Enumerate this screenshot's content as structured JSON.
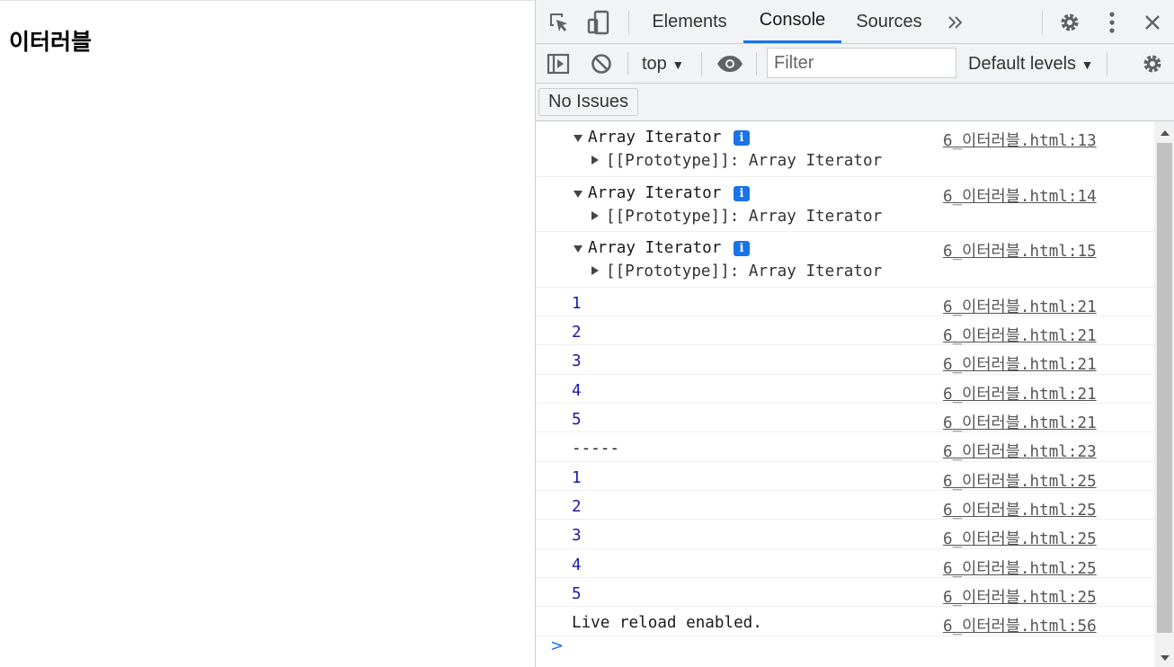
{
  "page": {
    "title": "이터러블"
  },
  "devtools": {
    "tabs": [
      {
        "label": "Elements"
      },
      {
        "label": "Console"
      },
      {
        "label": "Sources"
      }
    ],
    "more_tabs_icon": "double-chevron-right",
    "context": "top",
    "filter_placeholder": "Filter",
    "levels": "Default levels",
    "issues_label": "No Issues",
    "colors": {
      "accent": "#1a73e8",
      "number": "#1a1aa6",
      "toolbar_bg": "#f1f3f4"
    }
  },
  "console": {
    "iterator_entries": [
      {
        "label": "Array Iterator",
        "badge": "i",
        "child": "[[Prototype]]: Array Iterator",
        "source": "6_이터러블.html:13"
      },
      {
        "label": "Array Iterator",
        "badge": "i",
        "child": "[[Prototype]]: Array Iterator",
        "source": "6_이터러블.html:14"
      },
      {
        "label": "Array Iterator",
        "badge": "i",
        "child": "[[Prototype]]: Array Iterator",
        "source": "6_이터러블.html:15"
      }
    ],
    "lines": [
      {
        "text": "1",
        "source": "6_이터러블.html:21"
      },
      {
        "text": "2",
        "source": "6_이터러블.html:21"
      },
      {
        "text": "3",
        "source": "6_이터러블.html:21"
      },
      {
        "text": "4",
        "source": "6_이터러블.html:21"
      },
      {
        "text": "5",
        "source": "6_이터러블.html:21"
      },
      {
        "text": "-----",
        "source": "6_이터러블.html:23"
      },
      {
        "text": "1",
        "source": "6_이터러블.html:25"
      },
      {
        "text": "2",
        "source": "6_이터러블.html:25"
      },
      {
        "text": "3",
        "source": "6_이터러블.html:25"
      },
      {
        "text": "4",
        "source": "6_이터러블.html:25"
      },
      {
        "text": "5",
        "source": "6_이터러블.html:25"
      },
      {
        "text": "Live reload enabled.",
        "source": "6_이터러블.html:56"
      }
    ],
    "prompt": ">"
  }
}
